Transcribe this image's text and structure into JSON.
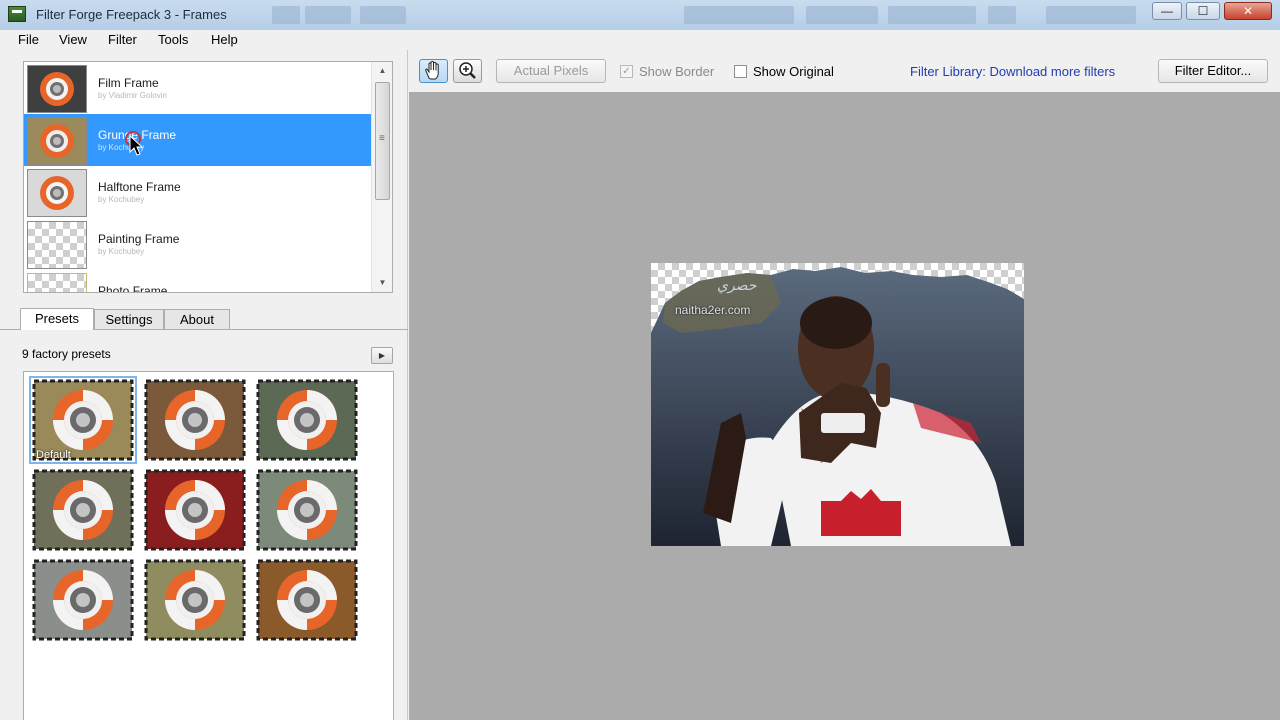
{
  "window": {
    "title": "Filter Forge Freepack 3 - Frames",
    "minimize_glyph": "—",
    "maximize_glyph": "☐",
    "close_glyph": "✕"
  },
  "menu": [
    "File",
    "View",
    "Filter",
    "Tools",
    "Help"
  ],
  "filters": [
    {
      "name": "Film Frame",
      "author": "by Vladimir Golovin",
      "selected": false
    },
    {
      "name": "Grunge Frame",
      "author": "by Kochubey",
      "selected": true
    },
    {
      "name": "Halftone Frame",
      "author": "by Kochubey",
      "selected": false
    },
    {
      "name": "Painting Frame",
      "author": "by Kochubey",
      "selected": false
    },
    {
      "name": "Photo Frame",
      "author": "",
      "selected": false
    }
  ],
  "scrollbar": {
    "up_glyph": "▲",
    "down_glyph": "▼"
  },
  "tabs": [
    {
      "label": "Presets",
      "active": true
    },
    {
      "label": "Settings",
      "active": false
    },
    {
      "label": "About",
      "active": false
    }
  ],
  "presets": {
    "count_label": "9 factory presets",
    "play_glyph": "▶",
    "items": [
      {
        "label": "Default",
        "tone": "#9a8a5a",
        "selected": true
      },
      {
        "label": "",
        "tone": "#7a5a3a",
        "selected": false
      },
      {
        "label": "",
        "tone": "#5c6a55",
        "selected": false
      },
      {
        "label": "",
        "tone": "#6f6f5a",
        "selected": false
      },
      {
        "label": "",
        "tone": "#8a1e1e",
        "selected": false
      },
      {
        "label": "",
        "tone": "#7c8a7a",
        "selected": false
      },
      {
        "label": "",
        "tone": "#8a8f8c",
        "selected": false
      },
      {
        "label": "",
        "tone": "#8f8d60",
        "selected": false
      },
      {
        "label": "",
        "tone": "#8a5a2a",
        "selected": false
      }
    ]
  },
  "toolbar": {
    "hand_tool_icon": "hand-icon",
    "zoom_tool_icon": "zoom-icon",
    "actual_pixels_label": "Actual Pixels",
    "show_border_label": "Show Border",
    "show_border_checked": true,
    "show_original_label": "Show Original",
    "show_original_checked": false,
    "library_link_label": "Filter Library: Download more filters",
    "filter_editor_label": "Filter Editor..."
  },
  "preview": {
    "watermark_text": "naitha2er.com",
    "watermark_arabic": "حصري"
  },
  "colors": {
    "selection": "#3399ff",
    "canvas_bg": "#ababab",
    "link": "#1f3eb0"
  }
}
